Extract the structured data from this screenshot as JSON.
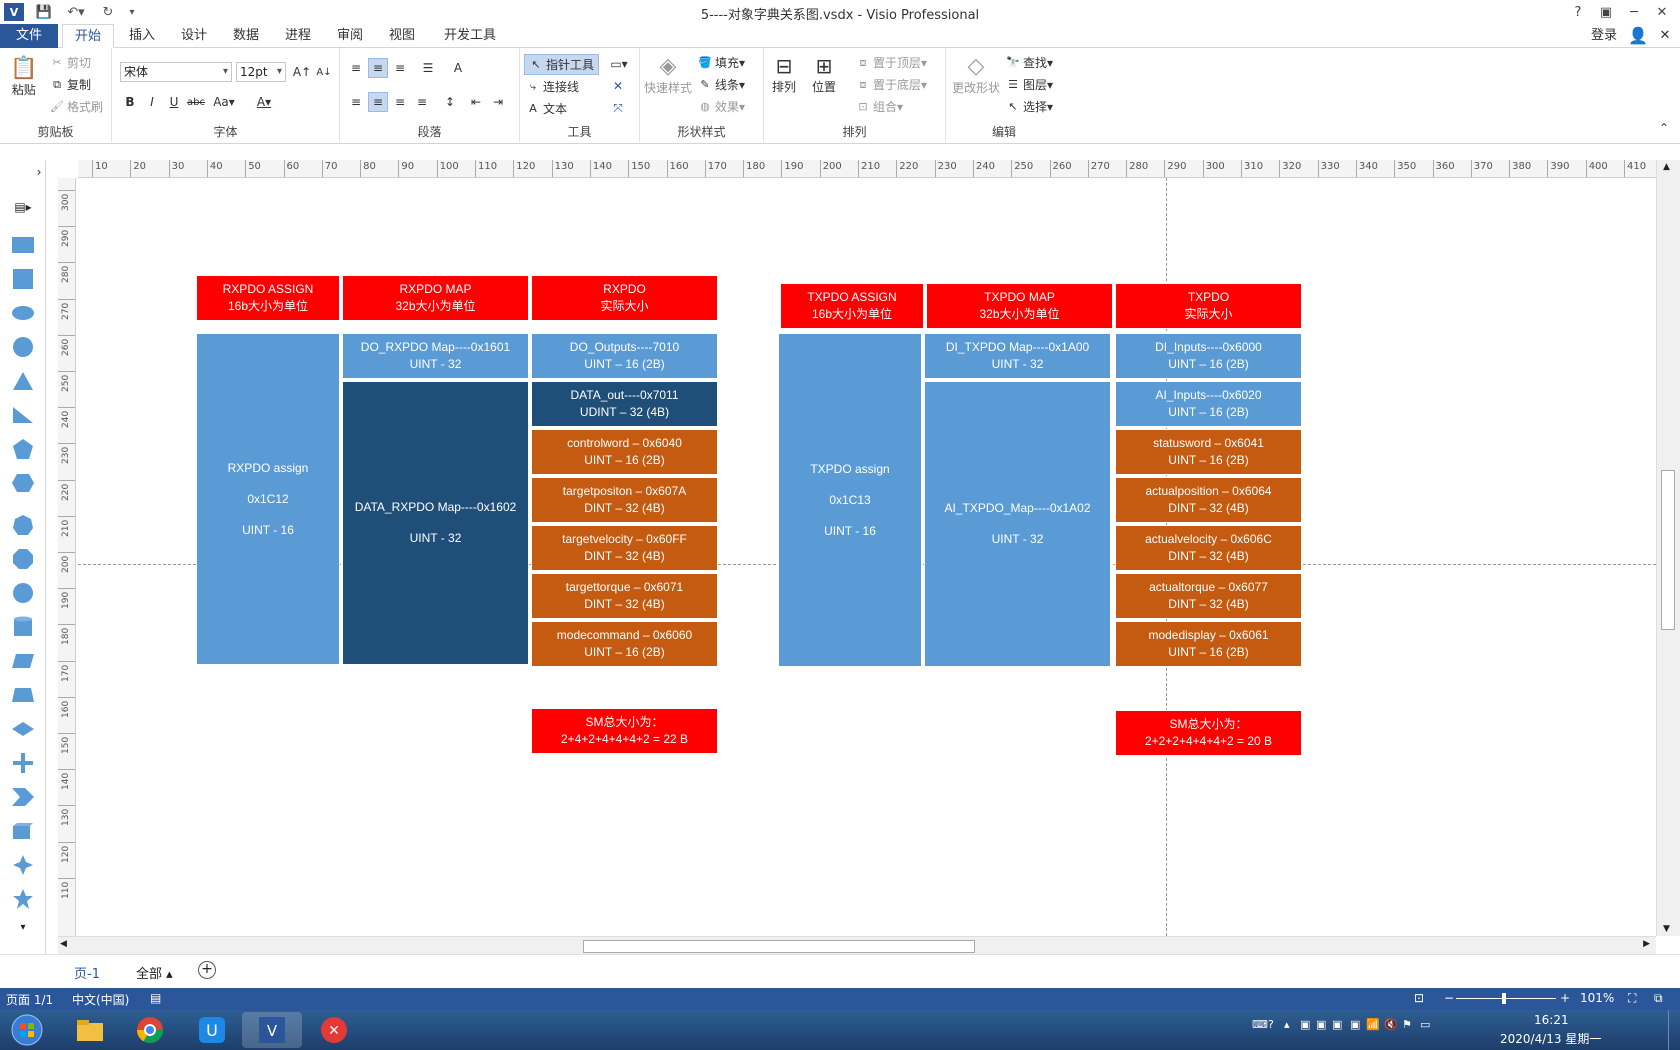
{
  "window": {
    "title": "5----对象字典关系图.vsdx - Visio Professional",
    "help": "?",
    "login": "登录"
  },
  "tabs": [
    "文件",
    "开始",
    "插入",
    "设计",
    "数据",
    "进程",
    "审阅",
    "视图",
    "开发工具"
  ],
  "ribbon": {
    "clipboard": {
      "label": "剪贴板",
      "paste": "粘贴",
      "cut": "剪切",
      "copy": "复制",
      "format_painter": "格式刷"
    },
    "font": {
      "label": "字体",
      "family": "宋体",
      "size": "12pt"
    },
    "paragraph": {
      "label": "段落"
    },
    "tools": {
      "label": "工具",
      "pointer": "指针工具",
      "connector": "连接线",
      "text": "文本"
    },
    "shape_styles": {
      "label": "形状样式",
      "quick_styles": "快速样式",
      "fill": "填充",
      "line": "线条",
      "effects": "效果"
    },
    "arrange": {
      "label": "排列",
      "arrange": "排列",
      "position": "位置",
      "bring_front": "置于顶层",
      "send_back": "置于底层",
      "group": "组合"
    },
    "edit": {
      "label": "编辑",
      "change_shape": "更改形状",
      "find": "查找",
      "layers": "图层",
      "select": "选择"
    }
  },
  "ruler": {
    "h": [
      "10",
      "20",
      "30",
      "40",
      "50",
      "60",
      "70",
      "80",
      "90",
      "100",
      "110",
      "120",
      "130",
      "140",
      "150",
      "160",
      "170",
      "180",
      "190",
      "200",
      "210",
      "220",
      "230",
      "240",
      "250",
      "260",
      "270",
      "280",
      "290",
      "300",
      "310",
      "320",
      "330",
      "340",
      "350",
      "360",
      "370",
      "380",
      "390",
      "400",
      "410"
    ],
    "v": [
      "300",
      "290",
      "280",
      "270",
      "260",
      "250",
      "240",
      "230",
      "220",
      "210",
      "200",
      "190",
      "180",
      "170",
      "160",
      "150",
      "140",
      "130",
      "120",
      "110"
    ]
  },
  "diagram": {
    "rx_headers": [
      {
        "l1": "RXPDO ASSIGN",
        "l2": "16b大小为单位"
      },
      {
        "l1": "RXPDO MAP",
        "l2": "32b大小为单位"
      },
      {
        "l1": "RXPDO",
        "l2": "实际大小"
      }
    ],
    "tx_headers": [
      {
        "l1": "TXPDO ASSIGN",
        "l2": "16b大小为单位"
      },
      {
        "l1": "TXPDO MAP",
        "l2": "32b大小为单位"
      },
      {
        "l1": "TXPDO",
        "l2": "实际大小"
      }
    ],
    "rx_assign": {
      "name": "RXPDO assign",
      "index": "0x1C12",
      "type": "UINT - 16"
    },
    "tx_assign": {
      "name": "TXPDO assign",
      "index": "0x1C13",
      "type": "UINT - 16"
    },
    "rx_maps": [
      {
        "l1": "DO_RXPDO Map----0x1601",
        "l2": "UINT - 32"
      },
      {
        "l1": "DATA_RXPDO Map----0x1602",
        "l2": "UINT - 32"
      }
    ],
    "tx_maps": [
      {
        "l1": "DI_TXPDO Map----0x1A00",
        "l2": "UINT - 32"
      },
      {
        "l1": "AI_TXPDO_Map----0x1A02",
        "l2": "UINT - 32"
      }
    ],
    "rx_objects": [
      {
        "l1": "DO_Outputs----7010",
        "l2": "UINT  –  16 (2B)"
      },
      {
        "l1": "DATA_out----0x7011",
        "l2": "UDINT  –  32 (4B)"
      },
      {
        "l1": "controlword  –  0x6040",
        "l2": "UINT  –  16 (2B)"
      },
      {
        "l1": "targetpositon  –  0x607A",
        "l2": "DINT  –  32 (4B)"
      },
      {
        "l1": "targetvelocity  –  0x60FF",
        "l2": "DINT  –  32 (4B)"
      },
      {
        "l1": "targettorque  –  0x6071",
        "l2": "DINT  –  32 (4B)"
      },
      {
        "l1": "modecommand  –  0x6060",
        "l2": "UINT  –  16 (2B)"
      }
    ],
    "tx_objects": [
      {
        "l1": "DI_Inputs----0x6000",
        "l2": "UINT  –  16 (2B)"
      },
      {
        "l1": "AI_Inputs----0x6020",
        "l2": "UINT  –  16 (2B)"
      },
      {
        "l1": "statusword  –  0x6041",
        "l2": "UINT  –  16 (2B)"
      },
      {
        "l1": "actualposition  –  0x6064",
        "l2": "DINT  –  32 (4B)"
      },
      {
        "l1": "actualvelocity  –  0x606C",
        "l2": "DINT  –  32 (4B)"
      },
      {
        "l1": "actualtorque  –  0x6077",
        "l2": "DINT  –  32 (4B)"
      },
      {
        "l1": "modedisplay  –  0x6061",
        "l2": "UINT  –  16 (2B)"
      }
    ],
    "rx_total": {
      "l1": "SM总大小为：",
      "l2": "2+4+2+4+4+4+2 = 22 B"
    },
    "tx_total": {
      "l1": "SM总大小为：",
      "l2": "2+2+2+4+4+4+2 = 20 B"
    }
  },
  "pages": {
    "current": "页-1",
    "all": "全部"
  },
  "status": {
    "page": "页面 1/1",
    "lang": "中文(中国)",
    "zoom": "101%"
  },
  "clock": {
    "time": "16:21",
    "date": "2020/4/13 星期一"
  },
  "colors": {
    "red": "#fe0000",
    "light_blue": "#5b9bd5",
    "dark_blue": "#1f4e79",
    "orange": "#c55a11",
    "accent": "#2b579a"
  }
}
